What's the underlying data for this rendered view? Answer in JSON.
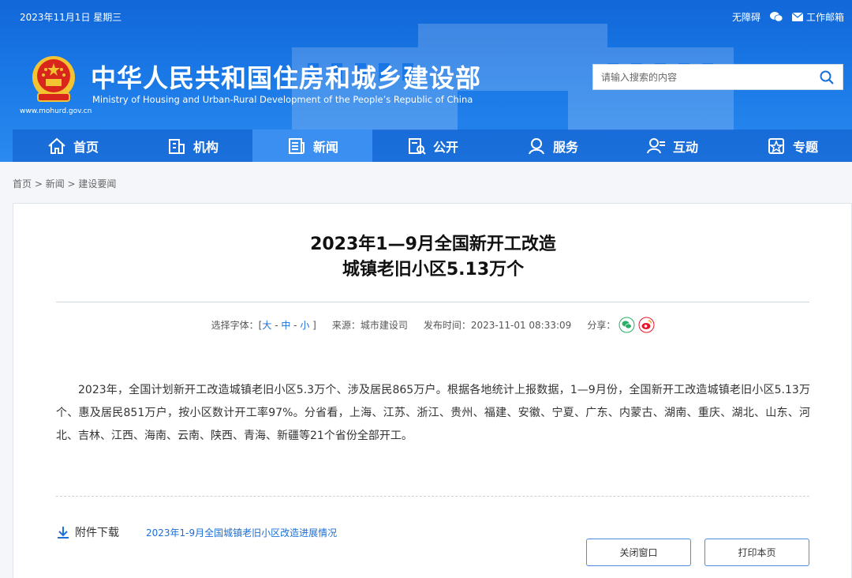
{
  "header": {
    "date": "2023年11月1日 星期三",
    "links": {
      "accessibility": "无障碍",
      "mail": "工作邮箱"
    },
    "site_url": "www.mohurd.gov.cn",
    "site_title": "中华人民共和国住房和城乡建设部",
    "site_subtitle": "Ministry of Housing and Urban-Rural Development of the People’s Republic of China",
    "search": {
      "placeholder": "请输入搜索的内容"
    }
  },
  "nav": {
    "items": [
      {
        "label": "首页",
        "icon": "home-icon"
      },
      {
        "label": "机构",
        "icon": "building-icon"
      },
      {
        "label": "新闻",
        "icon": "news-icon",
        "active": true
      },
      {
        "label": "公开",
        "icon": "disclosure-icon"
      },
      {
        "label": "服务",
        "icon": "service-icon"
      },
      {
        "label": "互动",
        "icon": "interaction-icon"
      },
      {
        "label": "专题",
        "icon": "topic-icon"
      }
    ]
  },
  "breadcrumb": {
    "items": [
      "首页",
      "新闻",
      "建设要闻"
    ],
    "sep": " > "
  },
  "article": {
    "title_line1": "2023年1—9月全国新开工改造",
    "title_line2": "城镇老旧小区5.13万个",
    "meta": {
      "font_label": "选择字体：[",
      "font_large": "大",
      "font_mid": "中",
      "font_small": "小",
      "font_sep": " - ",
      "font_close": " ]",
      "source": "来源：城市建设司",
      "published": "发布时间：2023-11-01 08:33:09",
      "share": "分享："
    },
    "body": "2023年，全国计划新开工改造城镇老旧小区5.3万个、涉及居民865万户。根据各地统计上报数据，1—9月份，全国新开工改造城镇老旧小区5.13万个、惠及居民851万户，按小区数计开工率97%。分省看，上海、江苏、浙江、贵州、福建、安徽、宁夏、广东、内蒙古、湖南、重庆、湖北、山东、河北、吉林、江西、海南、云南、陕西、青海、新疆等21个省份全部开工。",
    "attachment_label": "附件下载",
    "attachment_link": "2023年1-9月全国城镇老旧小区改造进展情况",
    "close_button": "关闭窗口",
    "print_button": "打印本页"
  },
  "colors": {
    "header_blue": "#1a78e6",
    "nav_active": "#3a8ff0",
    "link_blue": "#1a6fd8",
    "wechat_green": "#2aae67",
    "weibo_red": "#e6162d"
  }
}
